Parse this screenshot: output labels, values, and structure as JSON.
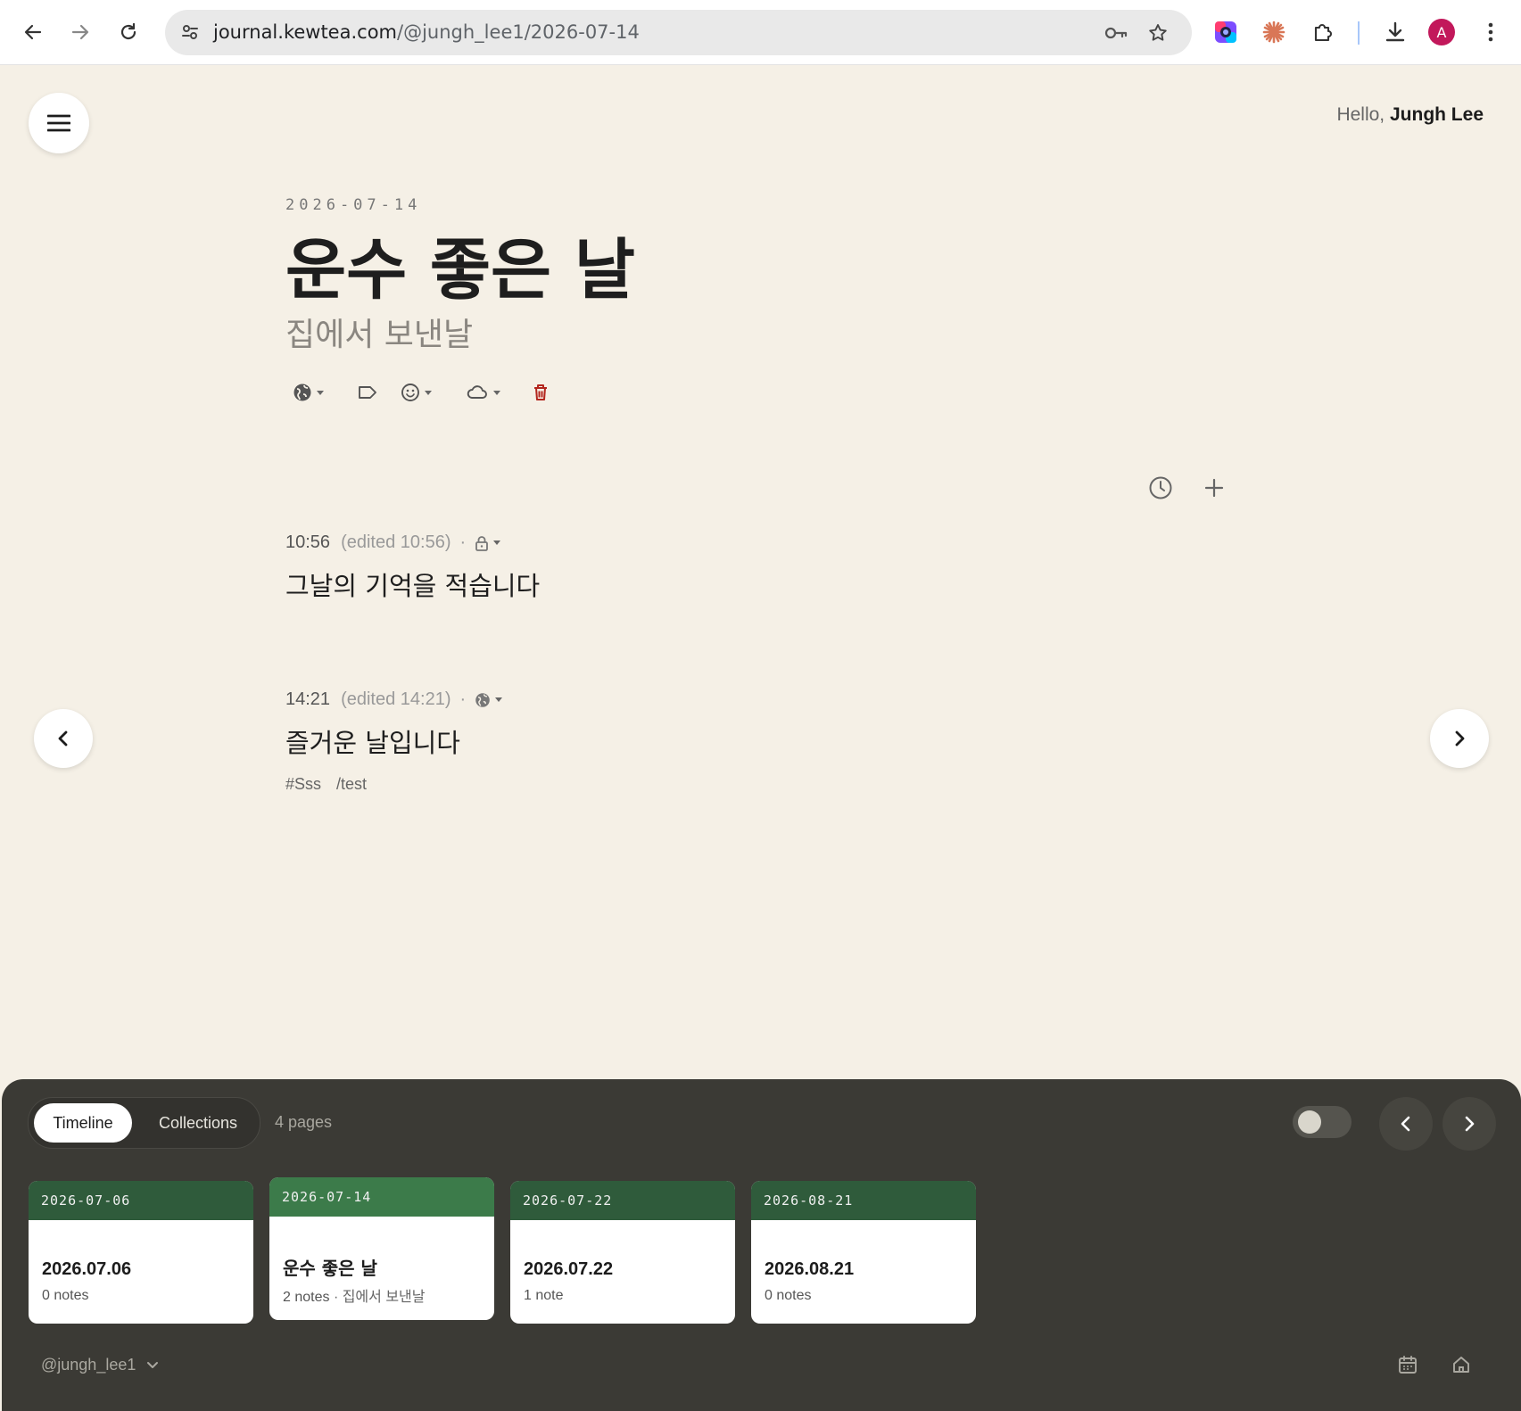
{
  "browser": {
    "url_host": "journal.kewtea.com",
    "url_path": "/@jungh_lee1/2026-07-14",
    "avatar_letter": "A"
  },
  "header": {
    "greeting": "Hello,",
    "user_name": "Jungh Lee"
  },
  "day": {
    "date_label": "2026-07-14",
    "title": "운수 좋은 날",
    "subtitle": "집에서 보낸날"
  },
  "entries": [
    {
      "time": "10:56",
      "edited": "(edited 10:56)",
      "dot": "·",
      "visibility_icon": "lock-icon",
      "body": "그날의 기억을 적습니다"
    },
    {
      "time": "14:21",
      "edited": "(edited 14:21)",
      "dot": "·",
      "visibility_icon": "globe-icon",
      "body": "즐거운 날입니다",
      "tags": [
        "#Sss",
        "/test"
      ]
    }
  ],
  "panel": {
    "tab_timeline": "Timeline",
    "tab_collections": "Collections",
    "page_count": "4 pages",
    "cards": [
      {
        "date": "2026-07-06",
        "title": "2026.07.06",
        "notes": "0 notes",
        "extra": ""
      },
      {
        "date": "2026-07-14",
        "title": "운수 좋은 날",
        "notes": "2 notes",
        "extra": "· 집에서 보낸날"
      },
      {
        "date": "2026-07-22",
        "title": "2026.07.22",
        "notes": "1 note",
        "extra": ""
      },
      {
        "date": "2026-08-21",
        "title": "2026.08.21",
        "notes": "0 notes",
        "extra": ""
      }
    ],
    "handle": "@jungh_lee1"
  },
  "colors": {
    "page_bg": "#f5f0e6",
    "panel_bg": "#3b3a35",
    "card_header": "#2f5b3b",
    "card_header_current": "#3c7b4a",
    "delete_red": "#b3261e"
  }
}
